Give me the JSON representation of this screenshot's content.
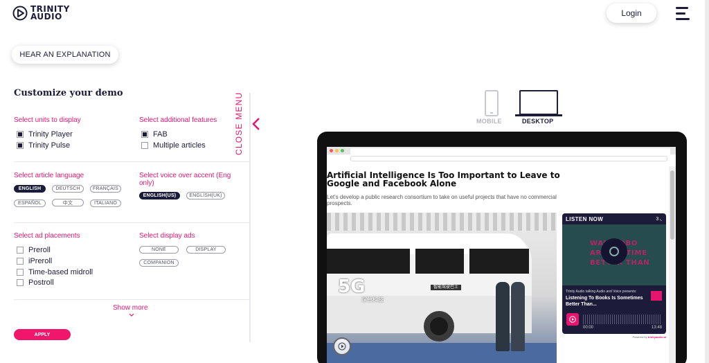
{
  "header": {
    "logo_line1": "TRINITY",
    "logo_line2": "AUDIO",
    "login_label": "Login"
  },
  "hear_explanation_label": "HEAR AN EXPLANATION",
  "panel": {
    "title": "Customize your demo",
    "close_menu_label": "CLOSE MENU",
    "units": {
      "label": "Select units to display",
      "items": [
        {
          "label": "Trinity Player",
          "checked": true
        },
        {
          "label": "Trinity Pulse",
          "checked": true
        }
      ]
    },
    "features": {
      "label": "Select additional features",
      "items": [
        {
          "label": "FAB",
          "checked": true
        },
        {
          "label": "Multiple articles",
          "checked": false
        }
      ]
    },
    "language": {
      "label": "Select article language",
      "options": [
        "ENGLISH",
        "DEUTSCH",
        "FRANÇAIS",
        "ESPAÑOL",
        "中文",
        "ITALIANO"
      ],
      "selected": "ENGLISH"
    },
    "accent": {
      "label": "Select voice over accent (Eng only)",
      "options": [
        "ENGLISH(US)",
        "ENGLISH(UK)"
      ],
      "selected": "ENGLISH(US)"
    },
    "ads": {
      "label": "Select ad placements",
      "items": [
        {
          "label": "Preroll",
          "checked": false
        },
        {
          "label": "iPreroll",
          "checked": false
        },
        {
          "label": "Time-based midroll",
          "checked": false
        },
        {
          "label": "Postroll",
          "checked": false
        }
      ]
    },
    "display_ads": {
      "label": "Select display ads",
      "options": [
        "NONE",
        "DISPLAY",
        "COMPANION"
      ]
    },
    "show_more_label": "Show more",
    "apply_label": "APPLY"
  },
  "devices": {
    "mobile_label": "MOBILE",
    "desktop_label": "DESKTOP",
    "selected": "DESKTOP"
  },
  "preview": {
    "article_title": "Artificial Intelligence Is Too Important to Leave to Google and Facebook Alone",
    "article_subtitle": "Let's develop a public research consortium to take on useful projects that have no commercial prospects.",
    "bus_5g_text": "5G",
    "bus_cn_text": "深兰科技",
    "bus_sign_text": "智能驾驶巴士",
    "player": {
      "header": "LISTEN NOW",
      "count": "3",
      "hero_lines": [
        "WAUDIOBO",
        "AREOMETIME",
        "BETTER THAN"
      ],
      "meta": "Trinity Audio talking Audio and Voice presents:",
      "title": "Listening To Books Is Sometimes Better Than...",
      "time_now": "00:00",
      "time_end": "13:48",
      "powered_prefix": "Powered by",
      "powered_brand": "trinityaudio.ai"
    }
  },
  "colors": {
    "accent": "#e6166f",
    "navy": "#1b1b3a",
    "player_bg": "#1d1b3a"
  }
}
